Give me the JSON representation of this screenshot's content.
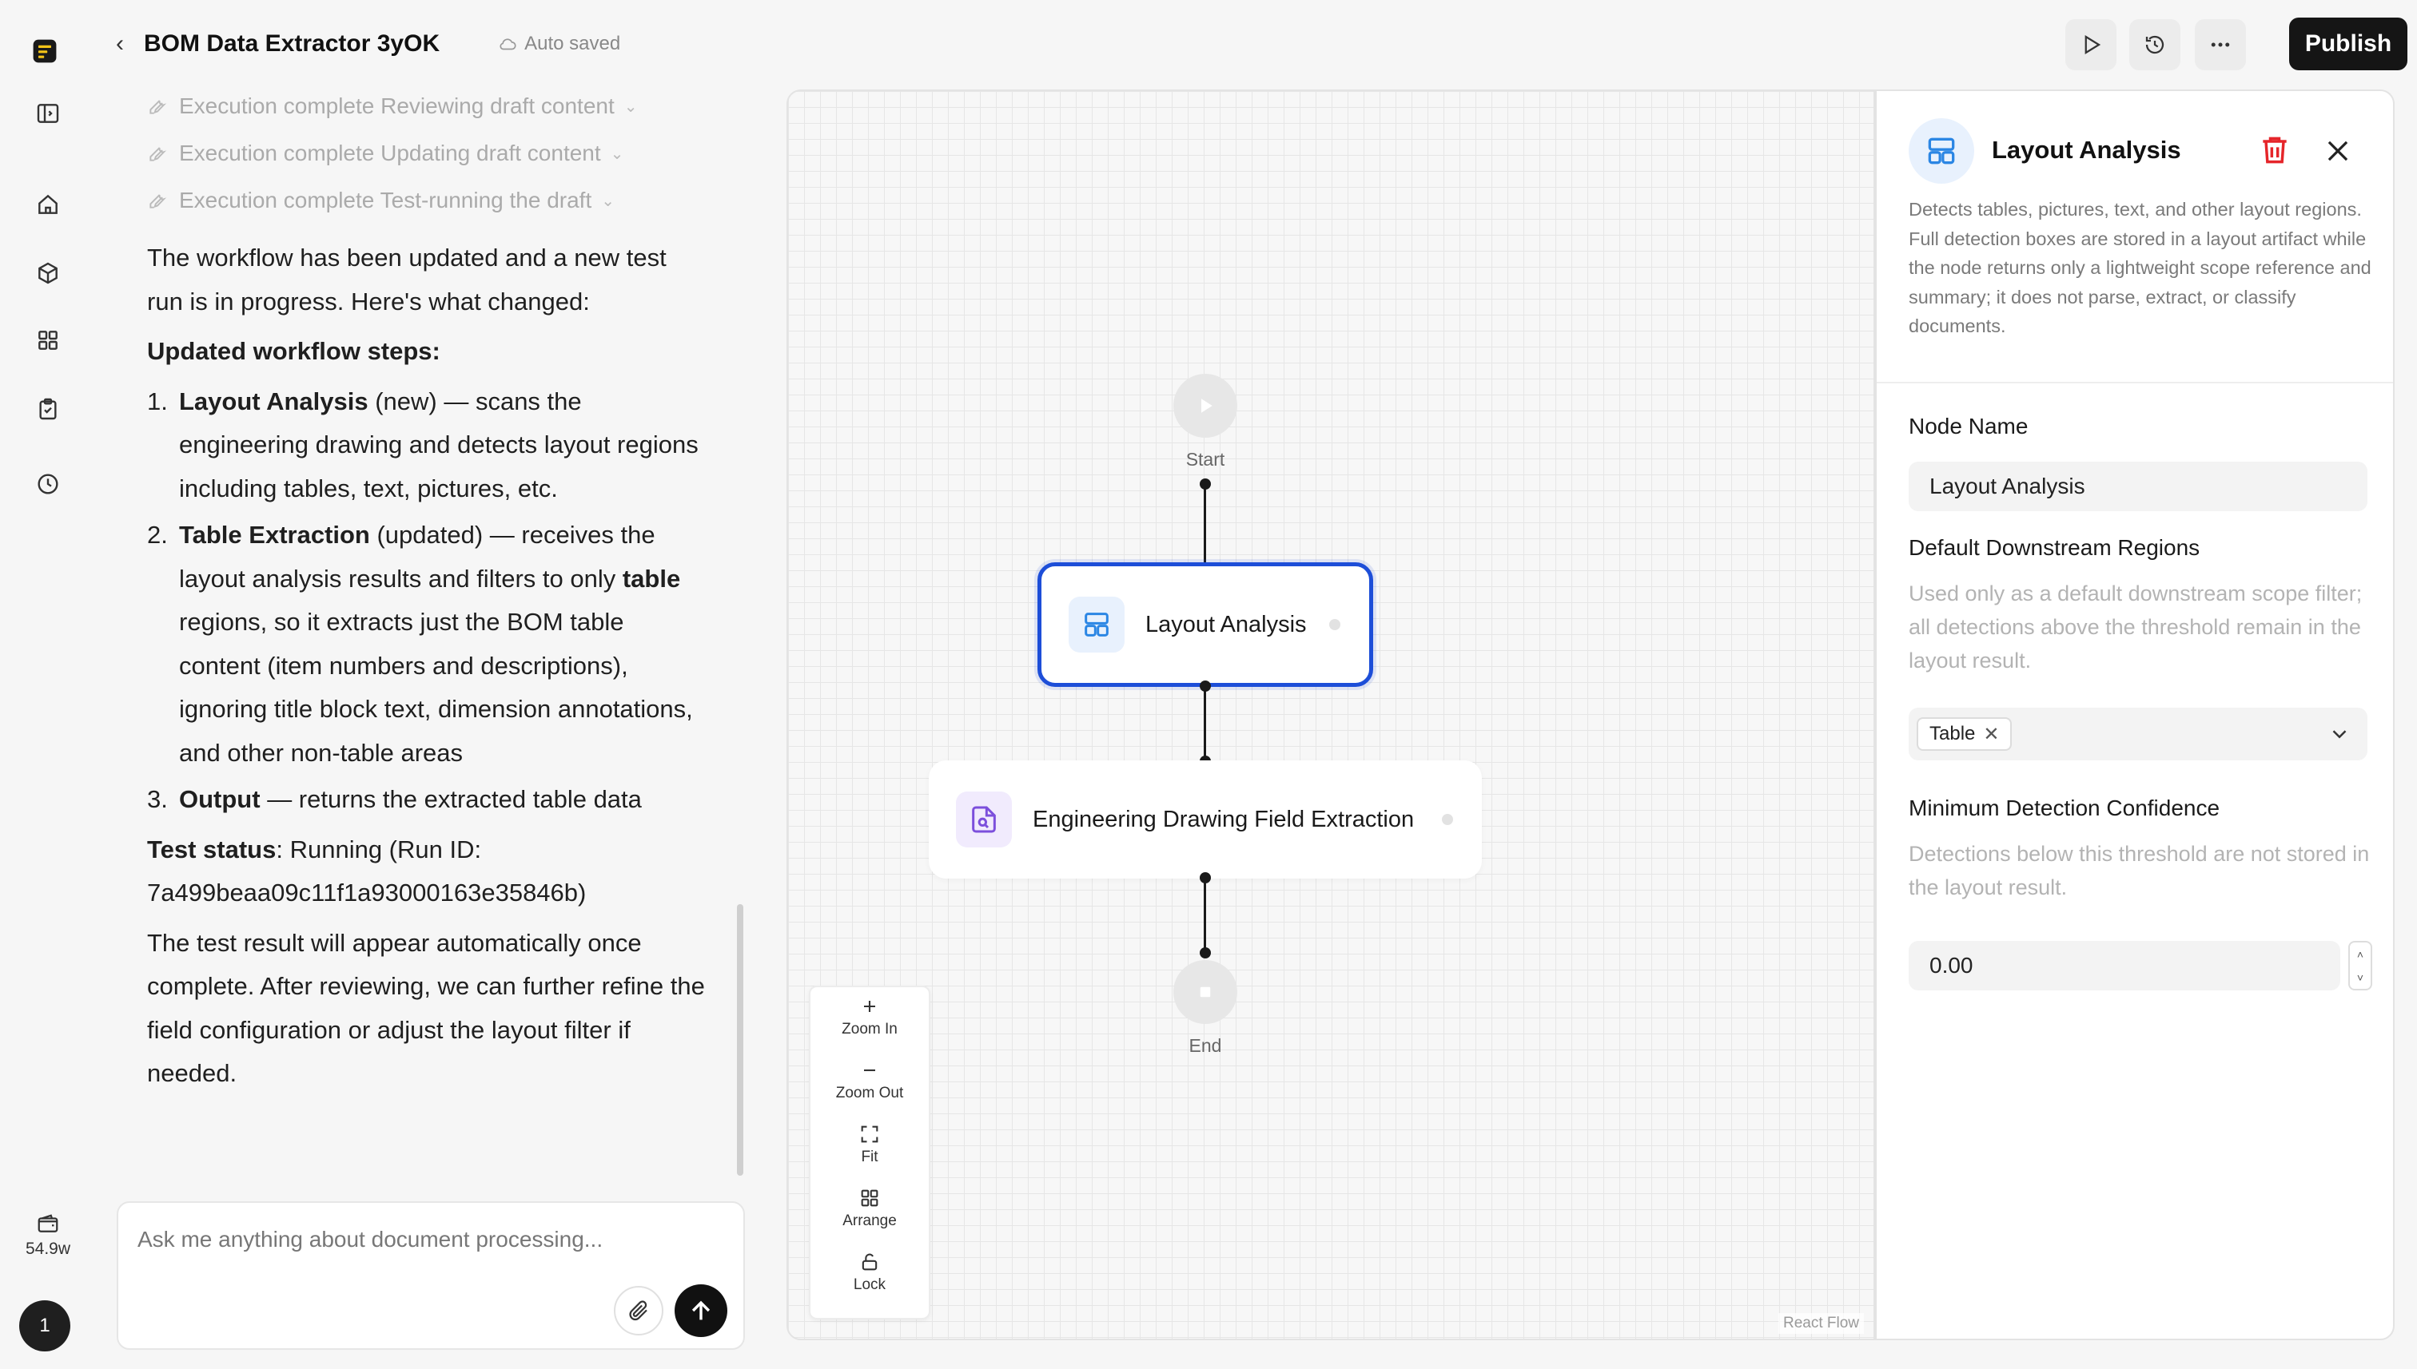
{
  "app": {
    "title": "BOM Data Extractor 3yOK",
    "autosave": "Auto saved",
    "credits": "54.9w",
    "avatar_initial": "1",
    "publish_label": "Publish",
    "accent_color": "#1d4ed8"
  },
  "rail": {
    "icons": [
      "sidebar-toggle-icon",
      "home-icon",
      "cube-icon",
      "grid-icon",
      "clipboard-icon",
      "history-icon"
    ]
  },
  "chat": {
    "exec_lines": [
      "Execution complete Reviewing draft content",
      "Execution complete Updating draft content",
      "Execution complete Test-running the draft"
    ],
    "intro": "The workflow has been updated and a new test run is in progress. Here's what changed:",
    "steps_heading": "Updated workflow steps:",
    "steps": [
      {
        "num": "1.",
        "name": "Layout Analysis",
        "rest": " (new) — scans the engineering drawing and detects layout regions including tables, text, pictures, etc."
      },
      {
        "num": "2.",
        "name": "Table Extraction",
        "rest_a": " (updated) — receives the layout analysis results and filters to only ",
        "bold_b": "table",
        "rest_b": " regions, so it extracts just the BOM table content (item numbers and descriptions), ignoring title block text, dimension annotations, and other non-table areas"
      },
      {
        "num": "3.",
        "name": "Output",
        "rest": " — returns the extracted table data"
      }
    ],
    "status_label": "Test status",
    "status_value": ": Running (Run ID: 7a499beaa09c11f1a93000163e35846b)",
    "closing": "The test result will appear automatically once complete. After reviewing, we can further refine the field configuration or adjust the layout filter if needed.",
    "composer_placeholder": "Ask me anything about document processing..."
  },
  "canvas": {
    "start_label": "Start",
    "end_label": "End",
    "nodes": [
      {
        "label": "Layout Analysis",
        "selected": true
      },
      {
        "label": "Engineering Drawing Field Extraction",
        "selected": false
      }
    ],
    "controls": [
      "Zoom In",
      "Zoom Out",
      "Fit",
      "Arrange",
      "Lock"
    ],
    "attribution": "React Flow"
  },
  "panel": {
    "title": "Layout Analysis",
    "description": "Detects tables, pictures, text, and other layout regions. Full detection boxes are stored in a layout artifact while the node returns only a lightweight scope reference and summary; it does not parse, extract, or classify documents.",
    "node_name_label": "Node Name",
    "node_name_value": "Layout Analysis",
    "regions_label": "Default Downstream Regions",
    "regions_help": "Used only as a default downstream scope filter; all detections above the threshold remain in the layout result.",
    "regions_selected": [
      "Table"
    ],
    "confidence_label": "Minimum Detection Confidence",
    "confidence_help": "Detections below this threshold are not stored in the layout result.",
    "confidence_value": "0.00"
  }
}
